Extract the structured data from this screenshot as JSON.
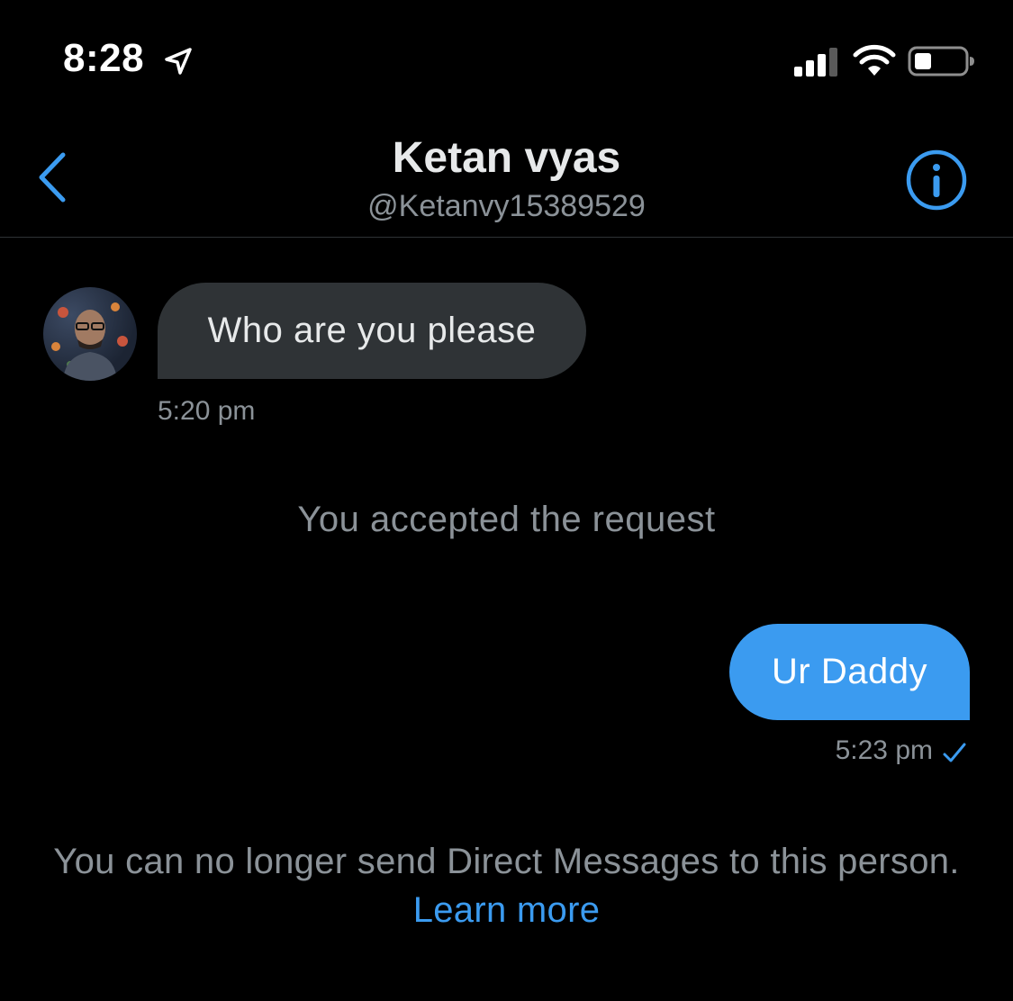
{
  "status_bar": {
    "time": "8:28",
    "icons": [
      "location-arrow-icon",
      "cellular-signal-icon",
      "wifi-icon",
      "battery-icon"
    ]
  },
  "header": {
    "back_icon": "chevron-left-icon",
    "title": "Ketan vyas",
    "handle": "@Ketanvy15389529",
    "info_icon": "info-icon"
  },
  "conversation": {
    "incoming": {
      "text": "Who are you please",
      "time": "5:20 pm"
    },
    "system_note": "You accepted the request",
    "outgoing": {
      "text": "Ur Daddy",
      "time": "5:23 pm",
      "status_icon": "checkmark-icon"
    }
  },
  "footer": {
    "text": "You can no longer send Direct Messages to this person.",
    "link": "Learn more"
  },
  "colors": {
    "background": "#000000",
    "accent": "#3b9bf0",
    "bubble_incoming": "#2f3336",
    "muted_text": "#8b9298"
  }
}
